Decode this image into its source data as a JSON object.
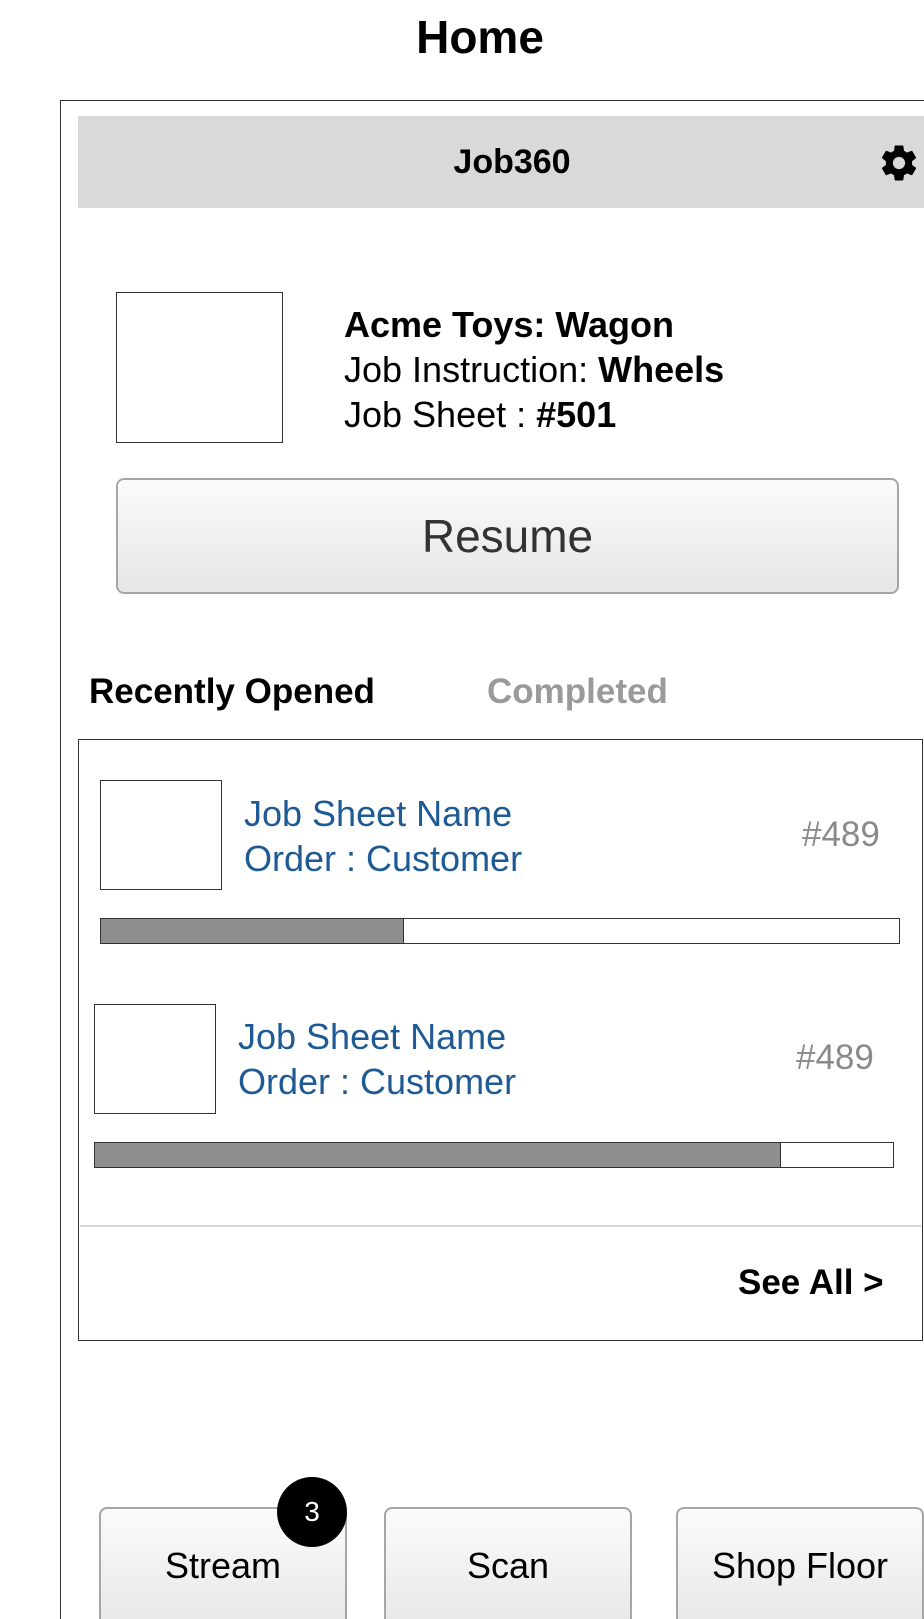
{
  "page_title": "Home",
  "app": {
    "title": "Job360",
    "settings_icon": "gear-icon"
  },
  "current_job": {
    "name": "Acme Toys: Wagon",
    "instruction_label": "Job Instruction: ",
    "instruction_value": "Wheels",
    "sheet_label": "Job Sheet : ",
    "sheet_value": "#501",
    "resume_label": "Resume"
  },
  "tabs": {
    "recent": "Recently Opened",
    "completed": "Completed"
  },
  "items": [
    {
      "name": "Job Sheet Name",
      "order": "Order : Customer",
      "number": "#489",
      "progress": 0.38
    },
    {
      "name": "Job Sheet Name",
      "order": "Order : Customer",
      "number": "#489",
      "progress": 0.86
    }
  ],
  "see_all": "See All >",
  "nav": {
    "stream": "Stream",
    "stream_badge": "3",
    "scan": "Scan",
    "shop_floor": "Shop Floor"
  },
  "colors": {
    "header_bg": "#d9d9d9",
    "link_blue": "#1e5a93",
    "muted_gray": "#9a9a9a",
    "progress_fill": "#8e8e8e"
  }
}
